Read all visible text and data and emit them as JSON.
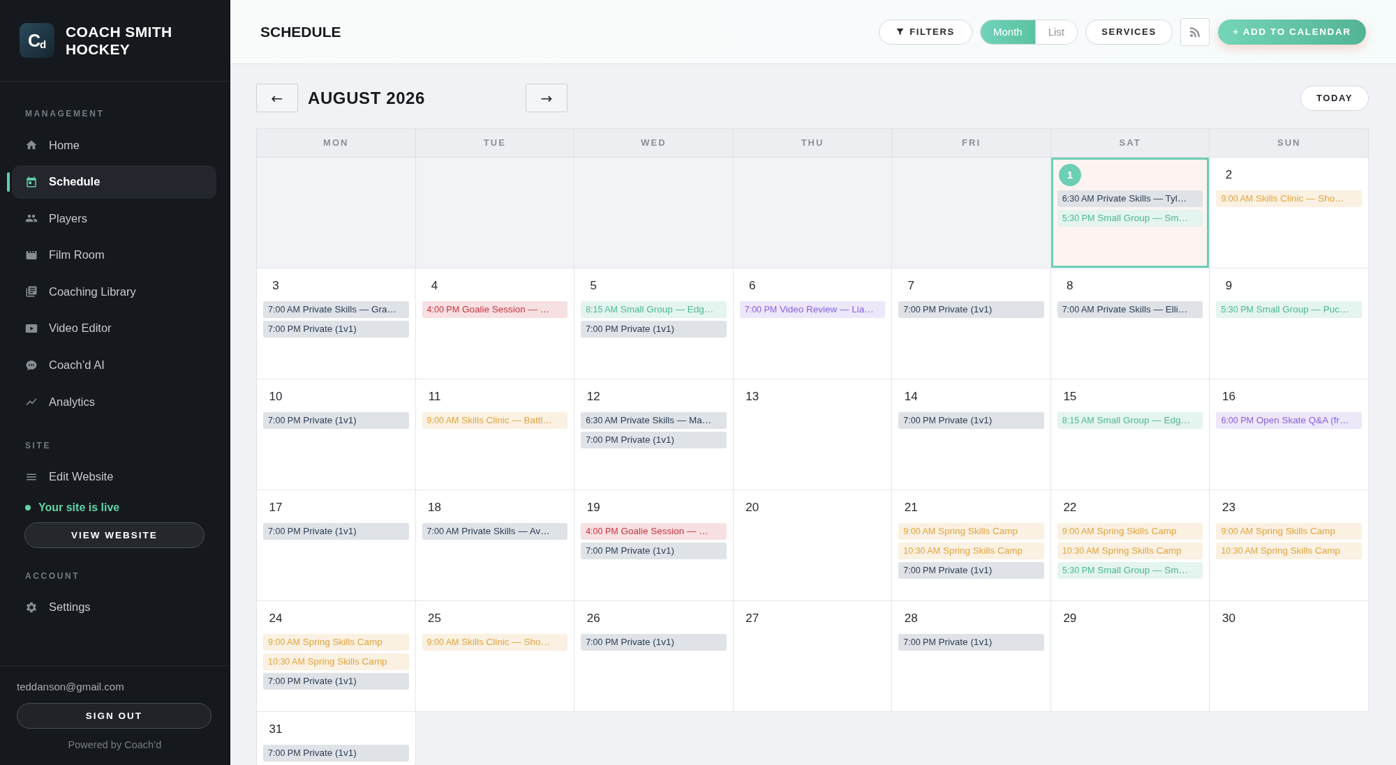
{
  "sidebar": {
    "brand": {
      "logo": "C$_{d}$",
      "name": "COACH SMITH HOCKEY"
    },
    "sections": [
      {
        "heading": "MANAGEMENT",
        "items": [
          {
            "label": "Home",
            "selected": false
          },
          {
            "label": "Schedule",
            "selected": true
          },
          {
            "label": "Players",
            "selected": false
          },
          {
            "label": "Film Room",
            "selected": false
          },
          {
            "label": "Coaching Library",
            "selected": false
          },
          {
            "label": "Video Editor",
            "selected": false
          },
          {
            "label": "Coach’d AI",
            "selected": false
          },
          {
            "label": "Analytics",
            "selected": false
          }
        ]
      },
      {
        "heading": "SITE",
        "items": [
          {
            "label": "Edit Website",
            "selected": false
          }
        ],
        "status": "Your site is live",
        "button": "VIEW WEBSITE"
      },
      {
        "heading": "ACCOUNT",
        "items": [
          {
            "label": "Settings",
            "selected": false
          }
        ]
      }
    ],
    "footer": {
      "email": "teddanson@gmail.com",
      "sign_out_button": "SIGN OUT",
      "powered_by": "Powered by Coach’d"
    }
  },
  "header": {
    "title": "SCHEDULE",
    "filters_button": "FILTERS",
    "view_tabs": [
      {
        "label": "Month",
        "selected": true
      },
      {
        "label": "List",
        "selected": false
      }
    ],
    "services_button": "SERVICES",
    "add_button": "+ ADD TO CALENDAR"
  },
  "calendar": {
    "prev_button": "←",
    "month_title": "AUGUST 2026",
    "next_button": "→",
    "today_button": "TODAY",
    "weekdays": [
      "MON",
      "TUE",
      "WED",
      "THU",
      "FRI",
      "SAT",
      "SUN"
    ],
    "weeks": [
      [
        {
          "day": "1",
          "today": true,
          "events": [
            {
              "time": "6:30 AM",
              "title": "Private Skills — Tyl…",
              "color": "#2c3e56"
            },
            {
              "time": "5:30 PM",
              "title": "Small Group — Sm…",
              "color": "#4bb893"
            }
          ]
        },
        {
          "day": "2",
          "today": false,
          "events": [
            {
              "time": "9:00 AM",
              "title": "Skills Clinic — Sho…",
              "color": "#e0a43f"
            }
          ]
        }
      ],
      [
        {
          "day": "3",
          "today": false,
          "events": [
            {
              "time": "7:00 AM",
              "title": "Private Skills — Gra…",
              "color": "#2c3e56"
            },
            {
              "time": "7:00 PM",
              "title": "Private (1v1)",
              "color": "#2c3e56"
            }
          ]
        },
        {
          "day": "4",
          "today": false,
          "events": [
            {
              "time": "4:00 PM",
              "title": "Goalie Session — …",
              "color": "#c9323f"
            }
          ]
        },
        {
          "day": "5",
          "today": false,
          "events": [
            {
              "time": "8:15 AM",
              "title": "Small Group — Edg…",
              "color": "#4bb893"
            },
            {
              "time": "7:00 PM",
              "title": "Private (1v1)",
              "color": "#2c3e56"
            }
          ]
        },
        {
          "day": "6",
          "today": false,
          "events": [
            {
              "time": "7:00 PM",
              "title": "Video Review — Lia…",
              "color": "#8462e0"
            }
          ]
        },
        {
          "day": "7",
          "today": false,
          "events": [
            {
              "time": "7:00 PM",
              "title": "Private (1v1)",
              "color": "#2c3e56"
            }
          ]
        },
        {
          "day": "8",
          "today": false,
          "events": [
            {
              "time": "7:00 AM",
              "title": "Private Skills — Elli…",
              "color": "#2c3e56"
            }
          ]
        },
        {
          "day": "9",
          "today": false,
          "events": [
            {
              "time": "5:30 PM",
              "title": "Small Group — Puc…",
              "color": "#4bb893"
            }
          ]
        }
      ],
      [
        {
          "day": "10",
          "today": false,
          "events": [
            {
              "time": "7:00 PM",
              "title": "Private (1v1)",
              "color": "#2c3e56"
            }
          ]
        },
        {
          "day": "11",
          "today": false,
          "events": [
            {
              "time": "9:00 AM",
              "title": "Skills Clinic — Battl…",
              "color": "#e0a43f"
            }
          ]
        },
        {
          "day": "12",
          "today": false,
          "events": [
            {
              "time": "6:30 AM",
              "title": "Private Skills — Ma…",
              "color": "#2c3e56"
            },
            {
              "time": "7:00 PM",
              "title": "Private (1v1)",
              "color": "#2c3e56"
            }
          ]
        },
        {
          "day": "13",
          "today": false
        },
        {
          "day": "14",
          "today": false,
          "events": [
            {
              "time": "7:00 PM",
              "title": "Private (1v1)",
              "color": "#2c3e56"
            }
          ]
        },
        {
          "day": "15",
          "today": false,
          "events": [
            {
              "time": "8:15 AM",
              "title": "Small Group — Edg…",
              "color": "#4bb893"
            }
          ]
        },
        {
          "day": "16",
          "today": false,
          "events": [
            {
              "time": "6:00 PM",
              "title": "Open Skate Q&A (fr…",
              "color": "#8462e0"
            }
          ]
        }
      ],
      [
        {
          "day": "17",
          "today": false,
          "events": [
            {
              "time": "7:00 PM",
              "title": "Private (1v1)",
              "color": "#2c3e56"
            }
          ]
        },
        {
          "day": "18",
          "today": false,
          "events": [
            {
              "time": "7:00 AM",
              "title": "Private Skills — Av…",
              "color": "#2c3e56"
            }
          ]
        },
        {
          "day": "19",
          "today": false,
          "events": [
            {
              "time": "4:00 PM",
              "title": "Goalie Session — …",
              "color": "#c9323f"
            },
            {
              "time": "7:00 PM",
              "title": "Private (1v1)",
              "color": "#2c3e56"
            }
          ]
        },
        {
          "day": "20",
          "today": false
        },
        {
          "day": "21",
          "today": false,
          "events": [
            {
              "time": "9:00 AM",
              "title": "Spring Skills Camp",
              "color": "#e0a43f"
            },
            {
              "time": "10:30 AM",
              "title": "Spring Skills Camp",
              "color": "#e0a43f"
            },
            {
              "time": "7:00 PM",
              "title": "Private (1v1)",
              "color": "#2c3e56"
            }
          ]
        },
        {
          "day": "22",
          "today": false,
          "events": [
            {
              "time": "9:00 AM",
              "title": "Spring Skills Camp",
              "color": "#e0a43f"
            },
            {
              "time": "10:30 AM",
              "title": "Spring Skills Camp",
              "color": "#e0a43f"
            },
            {
              "time": "5:30 PM",
              "title": "Small Group — Sm…",
              "color": "#4bb893"
            }
          ]
        },
        {
          "day": "23",
          "today": false,
          "events": [
            {
              "time": "9:00 AM",
              "title": "Spring Skills Camp",
              "color": "#e0a43f"
            },
            {
              "time": "10:30 AM",
              "title": "Spring Skills Camp",
              "color": "#e0a43f"
            }
          ]
        }
      ],
      [
        {
          "day": "24",
          "today": false,
          "events": [
            {
              "time": "9:00 AM",
              "title": "Spring Skills Camp",
              "color": "#e0a43f"
            },
            {
              "time": "10:30 AM",
              "title": "Spring Skills Camp",
              "color": "#e0a43f"
            },
            {
              "time": "7:00 PM",
              "title": "Private (1v1)",
              "color": "#2c3e56"
            }
          ]
        },
        {
          "day": "25",
          "today": false,
          "events": [
            {
              "time": "9:00 AM",
              "title": "Skills Clinic — Sho…",
              "color": "#e0a43f"
            }
          ]
        },
        {
          "day": "26",
          "today": false,
          "events": [
            {
              "time": "7:00 PM",
              "title": "Private (1v1)",
              "color": "#2c3e56"
            }
          ]
        },
        {
          "day": "27",
          "today": false
        },
        {
          "day": "28",
          "today": false,
          "events": [
            {
              "time": "7:00 PM",
              "title": "Private (1v1)",
              "color": "#2c3e56"
            }
          ]
        },
        {
          "day": "29",
          "today": false
        },
        {
          "day": "30",
          "today": false
        }
      ],
      [
        {
          "day": "31",
          "today": false,
          "events": [
            {
              "time": "7:00 PM",
              "title": "Private (1v1)",
              "color": "#2c3e56"
            }
          ]
        }
      ]
    ]
  }
}
